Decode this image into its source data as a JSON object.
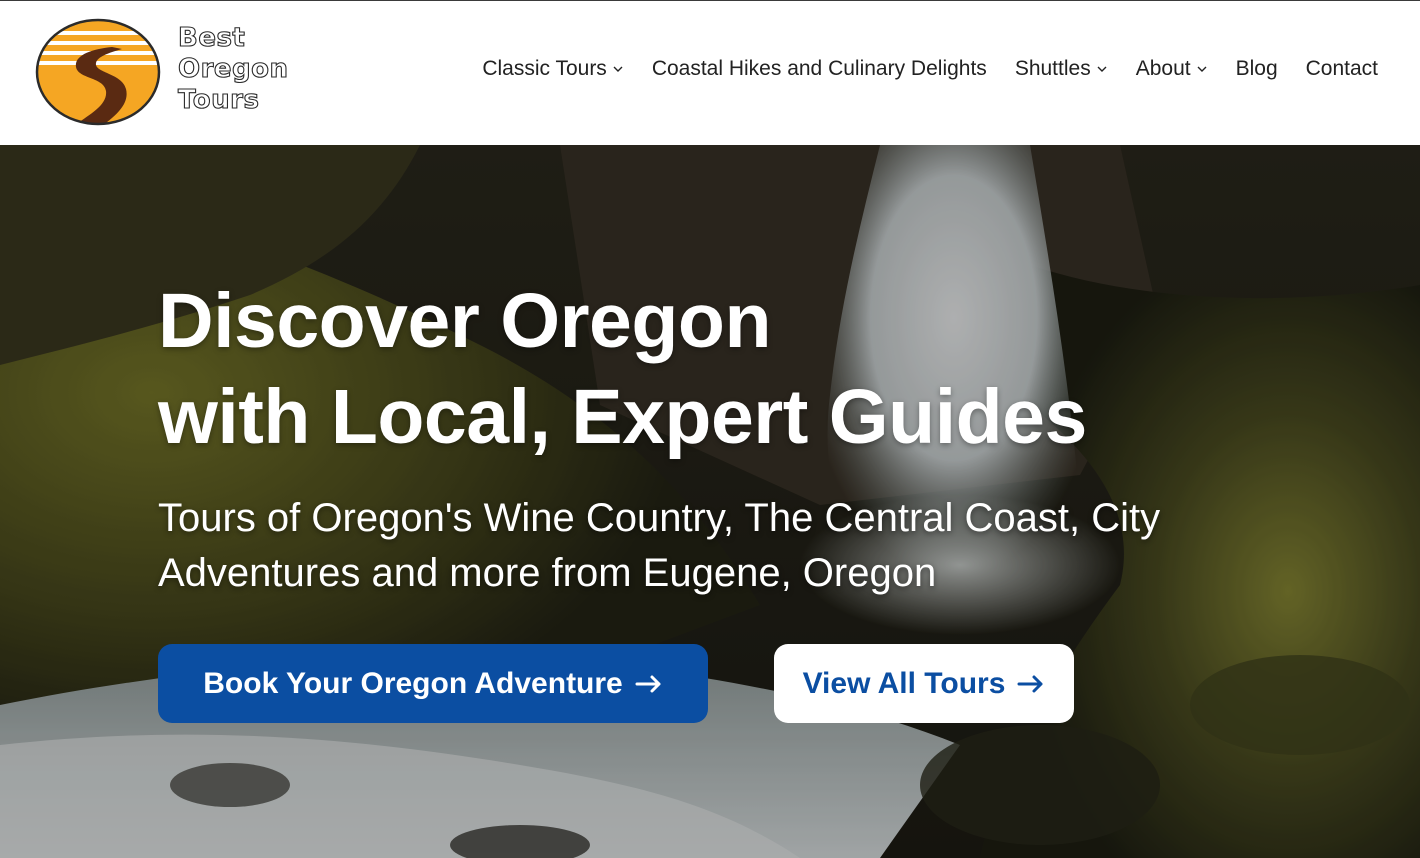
{
  "brand": {
    "name_lines": [
      "Best",
      "Oregon",
      "Tours"
    ],
    "logo_icon": "winding-road-sun-logo",
    "colors": {
      "sun": "#f5a623",
      "road": "#5a2a12",
      "outline": "#2b2b2b"
    }
  },
  "nav": {
    "items": [
      {
        "label": "Classic Tours",
        "has_dropdown": true
      },
      {
        "label": "Coastal Hikes and Culinary Delights",
        "has_dropdown": false
      },
      {
        "label": "Shuttles",
        "has_dropdown": true
      },
      {
        "label": "About",
        "has_dropdown": true
      },
      {
        "label": "Blog",
        "has_dropdown": false
      },
      {
        "label": "Contact",
        "has_dropdown": false
      }
    ]
  },
  "hero": {
    "background": "waterfall-mossy-gorge-photo",
    "title_line1": "Discover Oregon",
    "title_line2": "with Local, Expert Guides",
    "subtitle": "Tours of Oregon's Wine Country, The Central Coast, City Adventures and more from Eugene, Oregon",
    "primary_button": "Book Your Oregon Adventure",
    "secondary_button": "View All Tours",
    "colors": {
      "primary": "#0b4ea2",
      "on_primary": "#ffffff"
    }
  }
}
